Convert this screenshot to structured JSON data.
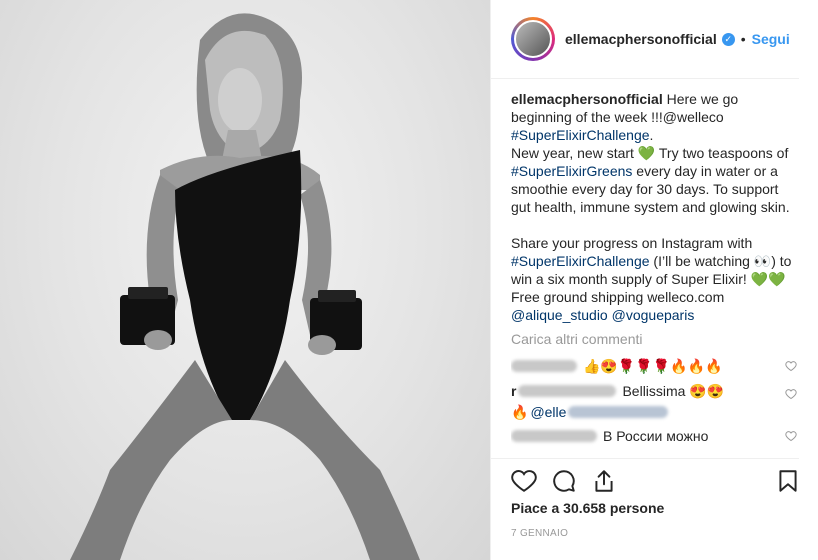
{
  "post": {
    "username": "ellemacphersonofficial",
    "verified": true,
    "separator": "•",
    "follow_label": "Segui",
    "caption": {
      "author": "ellemacphersonofficial",
      "line1": " Here we go beginning of the week !!!@welleco",
      "hashtag1": "#SuperElixirChallenge",
      "after_hashtag1": ".",
      "line2_pre": "New year, new start ",
      "green_heart": "💚",
      "line2_post": " Try two teaspoons of ",
      "hashtag2": "#SuperElixirGreens",
      "line3": " every day in water or a smoothie every day for 30 days. To support gut health, immune system and glowing skin.",
      "line4": "Share your progress on Instagram with",
      "hashtag3": "#SuperElixirChallenge",
      "line5": " (I’ll be watching 👀) to win a six month supply of Super Elixir! 💚💚 Free ground shipping welleco.com ",
      "mention1": "@alique_studio",
      "space": " ",
      "mention2": "@vogueparis"
    },
    "load_more_label": "Carica altri commenti",
    "comments": [
      {
        "text": "👍😍🌹🌹🌹🔥🔥🔥"
      },
      {
        "prefix": "r",
        "text": "Bellissima 😍😍",
        "line2_pre": "🔥",
        "mention": "@elle"
      },
      {
        "text": "В России можно"
      }
    ],
    "likes_label": "Piace a 30.658 persone",
    "date_label": "7 GENNAIO"
  },
  "icons": {
    "like": "heart-outline-icon",
    "comment": "speech-bubble-icon",
    "share": "share-icon",
    "save": "bookmark-icon"
  },
  "colors": {
    "link": "#003569",
    "follow": "#3897f0",
    "muted": "#999999"
  }
}
